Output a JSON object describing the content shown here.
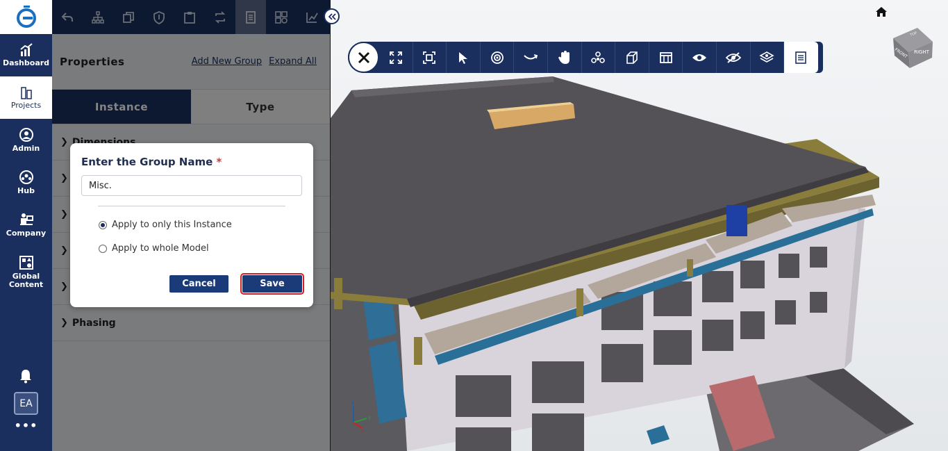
{
  "nav": {
    "items": [
      {
        "label": "Dashboard"
      },
      {
        "label": "Projects"
      },
      {
        "label": "Admin"
      },
      {
        "label": "Hub"
      },
      {
        "label": "Company"
      },
      {
        "label": "Global Content"
      }
    ],
    "avatar_initials": "EA",
    "more_label": "•••"
  },
  "panel": {
    "title": "Properties",
    "add_group_link": "Add New Group",
    "expand_all_link": "Expand All",
    "tabs": [
      {
        "label": "Instance"
      },
      {
        "label": "Type"
      }
    ],
    "sections": [
      {
        "label": "Dimensions"
      },
      {
        "label": ""
      },
      {
        "label": ""
      },
      {
        "label": ""
      },
      {
        "label": ""
      },
      {
        "label": "Phasing"
      }
    ]
  },
  "dialog": {
    "title": "Enter the Group Name",
    "required_mark": "*",
    "input_value": "Misc.",
    "options": [
      {
        "label": "Apply to only this Instance",
        "selected": true
      },
      {
        "label": "Apply to whole Model",
        "selected": false
      }
    ],
    "cancel_label": "Cancel",
    "save_label": "Save"
  },
  "viewcube": {
    "right_label": "RIGHT",
    "front_label": "FRONT",
    "top_label": "TOP"
  },
  "colors": {
    "brand_navy": "#1a2f5e",
    "save_outline": "#d21e1e"
  }
}
